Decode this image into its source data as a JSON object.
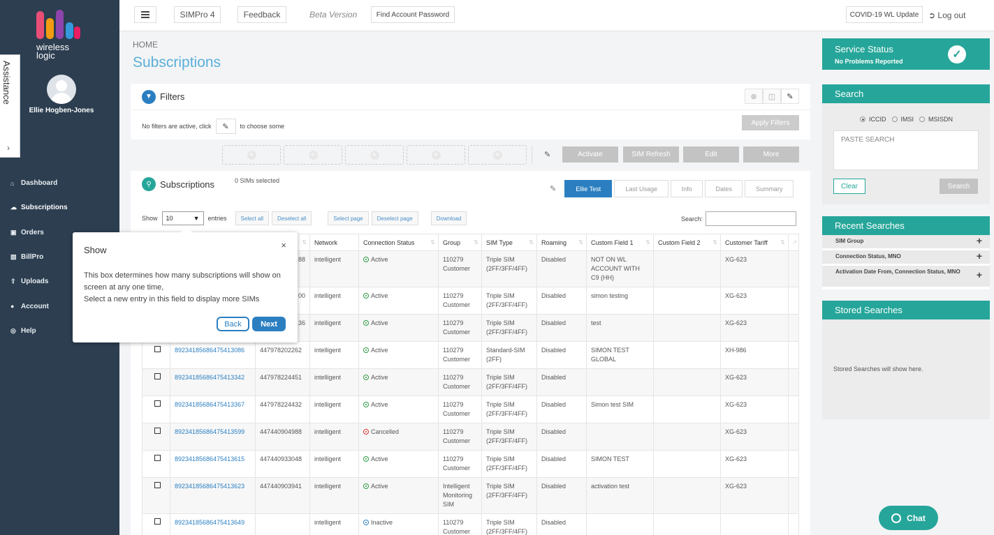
{
  "brand": {
    "logo_text": "wireless\nlogic",
    "colors": {
      "sidebar": "#2c3e50",
      "accent": "#26a69a",
      "link": "#2b7fc1"
    }
  },
  "user": {
    "name": "Ellie Hogben-Jones"
  },
  "assistance": {
    "label": "Assistance",
    "toggle_icon": "chevron-right-icon"
  },
  "nav": [
    {
      "label": "Dashboard",
      "icon": "home-icon",
      "active": false
    },
    {
      "label": "Subscriptions",
      "icon": "cloud-icon",
      "active": true
    },
    {
      "label": "Orders",
      "icon": "basket-icon",
      "active": false
    },
    {
      "label": "BillPro",
      "icon": "bar-chart-icon",
      "active": false
    },
    {
      "label": "Uploads",
      "icon": "upload-icon",
      "active": false
    },
    {
      "label": "Account",
      "icon": "user-icon",
      "active": false
    },
    {
      "label": "Help",
      "icon": "globe-icon",
      "active": false
    }
  ],
  "topbar": {
    "simpro": "SIMPro 4",
    "feedback": "Feedback",
    "beta": "Beta Version",
    "find_password": "Find Account Password",
    "covid": "COVID-19 WL Update",
    "logout": "Log out"
  },
  "breadcrumb": "HOME",
  "page_title": "Subscriptions",
  "filters": {
    "title": "Filters",
    "none_text": "No filters are active, click",
    "choose_text": "to choose some",
    "apply": "Apply Filters"
  },
  "actions": {
    "activate": "Activate",
    "sim_refresh": "SIM Refresh",
    "edit": "Edit",
    "more": "More"
  },
  "subscriptions": {
    "title": "Subscriptions",
    "selected": "0 SIMs selected",
    "tabs": [
      {
        "label": "Ellie Test",
        "active": true
      },
      {
        "label": "Last Usage",
        "active": false
      },
      {
        "label": "Info",
        "active": false
      },
      {
        "label": "Dates",
        "active": false
      },
      {
        "label": "Summary",
        "active": false
      }
    ],
    "show_label": "Show",
    "entries_value": "10",
    "entries_label": "entries",
    "buttons": {
      "select_all": "Select all",
      "deselect_all": "Deselect all",
      "select_page": "Select page",
      "deselect_page": "Deselect page",
      "download": "Download"
    },
    "search_label": "Search:",
    "columns": [
      "Network",
      "Connection Status",
      "Group",
      "SIM Type",
      "Roaming",
      "Custom Field 1",
      "Custom Field 2",
      "Customer Tariff"
    ],
    "rows": [
      {
        "iccid": "",
        "msisdn": "",
        "msisdn_tail": "88",
        "network": "intelligent",
        "status": "Active",
        "status_color": "green",
        "group": "110279 Customer",
        "sim_type": "Triple SIM (2FF/3FF/4FF)",
        "roaming": "Disabled",
        "cf1": "NOT ON WL ACCOUNT WITH C9 (HH)",
        "cf2": "",
        "tariff": "XG-623"
      },
      {
        "iccid": "",
        "msisdn": "",
        "msisdn_tail": "00",
        "network": "intelligent",
        "status": "Active",
        "status_color": "green",
        "group": "110279 Customer",
        "sim_type": "Triple SIM (2FF/3FF/4FF)",
        "roaming": "Disabled",
        "cf1": "simon testing",
        "cf2": "",
        "tariff": "XG-623"
      },
      {
        "iccid": "",
        "msisdn": "",
        "msisdn_tail": "36",
        "network": "intelligent",
        "status": "Active",
        "status_color": "green",
        "group": "110279 Customer",
        "sim_type": "Triple SIM (2FF/3FF/4FF)",
        "roaming": "Disabled",
        "cf1": "test",
        "cf2": "",
        "tariff": "XG-623"
      },
      {
        "iccid": "89234185686475413086",
        "msisdn": "447978202262",
        "msisdn_tail": "",
        "network": "intelligent",
        "status": "Active",
        "status_color": "green",
        "group": "110279 Customer",
        "sim_type": "Standard-SIM (2FF)",
        "roaming": "Disabled",
        "cf1": "SIMON TEST GLOBAL",
        "cf2": "",
        "tariff": "XH-986"
      },
      {
        "iccid": "89234185686475413342",
        "msisdn": "447978224451",
        "msisdn_tail": "",
        "network": "intelligent",
        "status": "Active",
        "status_color": "green",
        "group": "110279 Customer",
        "sim_type": "Triple SIM (2FF/3FF/4FF)",
        "roaming": "Disabled",
        "cf1": "",
        "cf2": "",
        "tariff": "XG-623"
      },
      {
        "iccid": "89234185686475413367",
        "msisdn": "447978224432",
        "msisdn_tail": "",
        "network": "intelligent",
        "status": "Active",
        "status_color": "green",
        "group": "110279 Customer",
        "sim_type": "Triple SIM (2FF/3FF/4FF)",
        "roaming": "Disabled",
        "cf1": "Simon test SIM",
        "cf2": "",
        "tariff": "XG-623"
      },
      {
        "iccid": "89234185686475413599",
        "msisdn": "447440904988",
        "msisdn_tail": "",
        "network": "intelligent",
        "status": "Cancelled",
        "status_color": "red",
        "group": "110279 Customer",
        "sim_type": "Triple SIM (2FF/3FF/4FF)",
        "roaming": "Disabled",
        "cf1": "",
        "cf2": "",
        "tariff": "XG-623"
      },
      {
        "iccid": "89234185686475413615",
        "msisdn": "447440933048",
        "msisdn_tail": "",
        "network": "intelligent",
        "status": "Active",
        "status_color": "green",
        "group": "110279 Customer",
        "sim_type": "Triple SIM (2FF/3FF/4FF)",
        "roaming": "Disabled",
        "cf1": "SIMON TEST",
        "cf2": "",
        "tariff": "XG-623"
      },
      {
        "iccid": "89234185686475413623",
        "msisdn": "447440903941",
        "msisdn_tail": "",
        "network": "intelligent",
        "status": "Active",
        "status_color": "green",
        "group": "Intelligent Monitoring SIM",
        "sim_type": "Triple SIM (2FF/3FF/4FF)",
        "roaming": "Disabled",
        "cf1": "activation test",
        "cf2": "",
        "tariff": "XG-623"
      },
      {
        "iccid": "89234185686475413649",
        "msisdn": "",
        "msisdn_tail": "",
        "network": "intelligent",
        "status": "Inactive",
        "status_color": "blue",
        "group": "110279 Customer",
        "sim_type": "Triple SIM (2FF/3FF/4FF)",
        "roaming": "Disabled",
        "cf1": "",
        "cf2": "",
        "tariff": ""
      }
    ]
  },
  "popover": {
    "title": "Show",
    "body_line1": "This box determines how many subscriptions will show on screen at any one time,",
    "body_line2": "Select a new entry in this field to display more SIMs",
    "back": "Back",
    "next": "Next"
  },
  "service_status": {
    "title": "Service Status",
    "subtitle": "No Problems Reported"
  },
  "search_panel": {
    "title": "Search",
    "options": [
      "ICCID",
      "IMSI",
      "MSISDN"
    ],
    "selected": "ICCID",
    "placeholder": "PASTE SEARCH",
    "clear": "Clear",
    "search": "Search"
  },
  "recent": {
    "title": "Recent Searches",
    "items": [
      "SIM Group",
      "Connection Status, MNO",
      "Activation Date From, Connection Status, MNO"
    ]
  },
  "stored": {
    "title": "Stored Searches",
    "empty": "Stored Searches will show here."
  },
  "chat": {
    "label": "Chat"
  }
}
